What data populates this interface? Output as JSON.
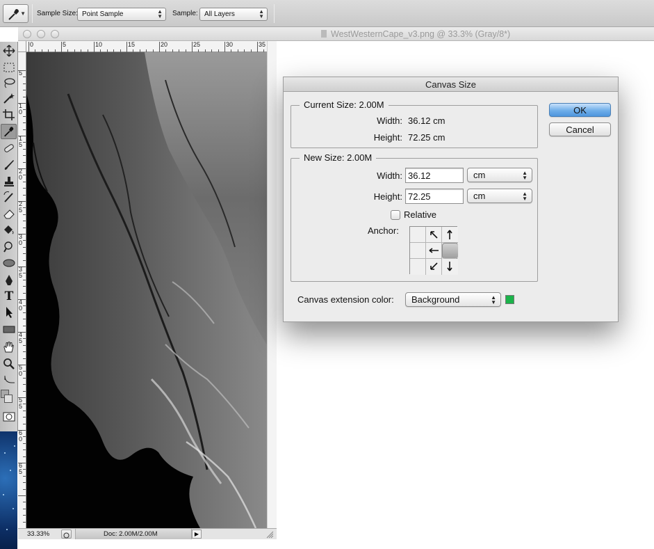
{
  "optionsBar": {
    "sampleSizeLabel": "Sample Size:",
    "sampleSizeValue": "Point Sample",
    "sampleLabel": "Sample:",
    "sampleValue": "All Layers"
  },
  "document": {
    "title": "WestWesternCape_v3.png @ 33.3% (Gray/8*)",
    "zoom": "33.33%",
    "docInfo": "Doc: 2.00M/2.00M"
  },
  "rulers": {
    "top": [
      "0",
      "5",
      "10",
      "15",
      "20",
      "25",
      "30",
      "35"
    ],
    "left": [
      "5",
      "1\n0",
      "1\n5",
      "2\n0",
      "2\n5",
      "3\n0",
      "3\n5",
      "4\n0",
      "4\n5",
      "5\n0",
      "5\n5",
      "6\n0",
      "6\n5"
    ]
  },
  "dialog": {
    "title": "Canvas Size",
    "current": {
      "legend": "Current Size: 2.00M",
      "widthLabel": "Width:",
      "widthValue": "36.12 cm",
      "heightLabel": "Height:",
      "heightValue": "72.25 cm"
    },
    "newSize": {
      "legend": "New Size: 2.00M",
      "widthLabel": "Width:",
      "widthValue": "36.12",
      "widthUnit": "cm",
      "heightLabel": "Height:",
      "heightValue": "72.25",
      "heightUnit": "cm",
      "relativeLabel": "Relative",
      "anchorLabel": "Anchor:"
    },
    "extension": {
      "label": "Canvas extension color:",
      "value": "Background",
      "swatchColor": "#1bb34a"
    },
    "okLabel": "OK",
    "cancelLabel": "Cancel"
  }
}
